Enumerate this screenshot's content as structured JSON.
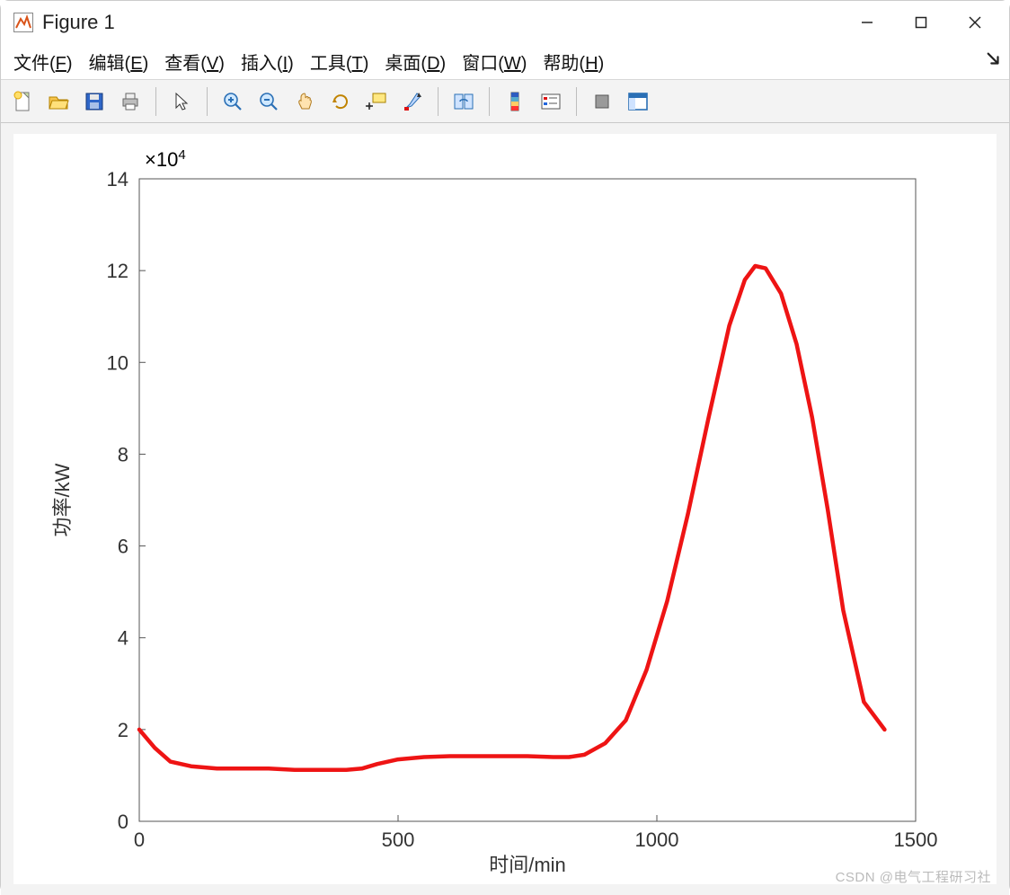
{
  "window": {
    "title": "Figure 1",
    "icon": "matlab-figure-icon"
  },
  "menu": {
    "items": [
      {
        "label_pre": "文件(",
        "mnemonic": "F",
        "label_post": ")"
      },
      {
        "label_pre": "编辑(",
        "mnemonic": "E",
        "label_post": ")"
      },
      {
        "label_pre": "查看(",
        "mnemonic": "V",
        "label_post": ")"
      },
      {
        "label_pre": "插入(",
        "mnemonic": "I",
        "label_post": ")"
      },
      {
        "label_pre": "工具(",
        "mnemonic": "T",
        "label_post": ")"
      },
      {
        "label_pre": "桌面(",
        "mnemonic": "D",
        "label_post": ")"
      },
      {
        "label_pre": "窗口(",
        "mnemonic": "W",
        "label_post": ")"
      },
      {
        "label_pre": "帮助(",
        "mnemonic": "H",
        "label_post": ")"
      }
    ]
  },
  "toolbar": {
    "icons": [
      "new-icon",
      "open-icon",
      "save-icon",
      "print-icon",
      "sep",
      "pointer-icon",
      "sep",
      "zoom-in-icon",
      "zoom-out-icon",
      "pan-icon",
      "rotate-icon",
      "data-cursor-icon",
      "brush-icon",
      "sep",
      "link-plots-icon",
      "sep",
      "colorbar-icon",
      "legend-icon",
      "sep",
      "hide-tools-icon",
      "dock-icon"
    ]
  },
  "watermark": "CSDN @电气工程研习社",
  "chart_data": {
    "type": "line",
    "xlabel": "时间/min",
    "ylabel": "功率/kW",
    "xlim": [
      0,
      1500
    ],
    "ylim": [
      0,
      14
    ],
    "xticks": [
      0,
      500,
      1000,
      1500
    ],
    "yticks": [
      0,
      2,
      4,
      6,
      8,
      10,
      12,
      14
    ],
    "y_multiplier_label": "×10",
    "y_multiplier_exp": "4",
    "y_scale_factor": 10000,
    "line_color": "#ee1414",
    "series": [
      {
        "name": "功率",
        "x": [
          0,
          30,
          60,
          100,
          150,
          200,
          250,
          300,
          350,
          400,
          430,
          460,
          500,
          550,
          600,
          650,
          700,
          750,
          800,
          830,
          860,
          900,
          940,
          980,
          1020,
          1060,
          1100,
          1140,
          1170,
          1190,
          1210,
          1240,
          1270,
          1300,
          1330,
          1360,
          1400,
          1440
        ],
        "y_e4": [
          2.0,
          1.6,
          1.3,
          1.2,
          1.15,
          1.15,
          1.15,
          1.12,
          1.12,
          1.12,
          1.15,
          1.25,
          1.35,
          1.4,
          1.42,
          1.42,
          1.42,
          1.42,
          1.4,
          1.4,
          1.45,
          1.7,
          2.2,
          3.3,
          4.8,
          6.7,
          8.8,
          10.8,
          11.8,
          12.1,
          12.05,
          11.5,
          10.4,
          8.8,
          6.8,
          4.6,
          2.6,
          2.0
        ]
      }
    ]
  }
}
